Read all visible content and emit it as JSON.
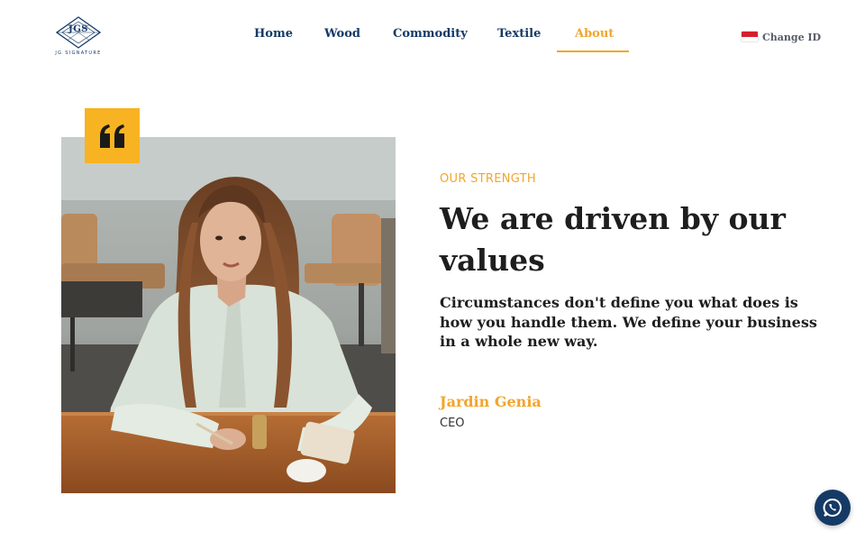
{
  "brand": {
    "logo_mark": "JGS",
    "logo_subtitle": "JG SIGNATURE"
  },
  "nav": {
    "items": [
      {
        "label": "Home",
        "active": false
      },
      {
        "label": "Wood",
        "active": false
      },
      {
        "label": "Commodity",
        "active": false
      },
      {
        "label": "Textile",
        "active": false
      },
      {
        "label": "About",
        "active": true
      }
    ]
  },
  "language": {
    "label": "Change ID",
    "flag": "indonesia-flag-icon"
  },
  "hero": {
    "quote_icon": "quote-icon",
    "eyebrow": "OUR STRENGTH",
    "headline": "We are driven by our values",
    "body": "Circumstances don't define you what does is how you handle them. We define your business in a whole new way.",
    "person_name": "Jardin Genia",
    "person_role": "CEO"
  },
  "chat": {
    "icon": "whatsapp-icon"
  },
  "colors": {
    "primary": "#163a66",
    "accent": "#f2a52b",
    "quote_badge": "#f7b322",
    "text": "#1e1e1e"
  }
}
